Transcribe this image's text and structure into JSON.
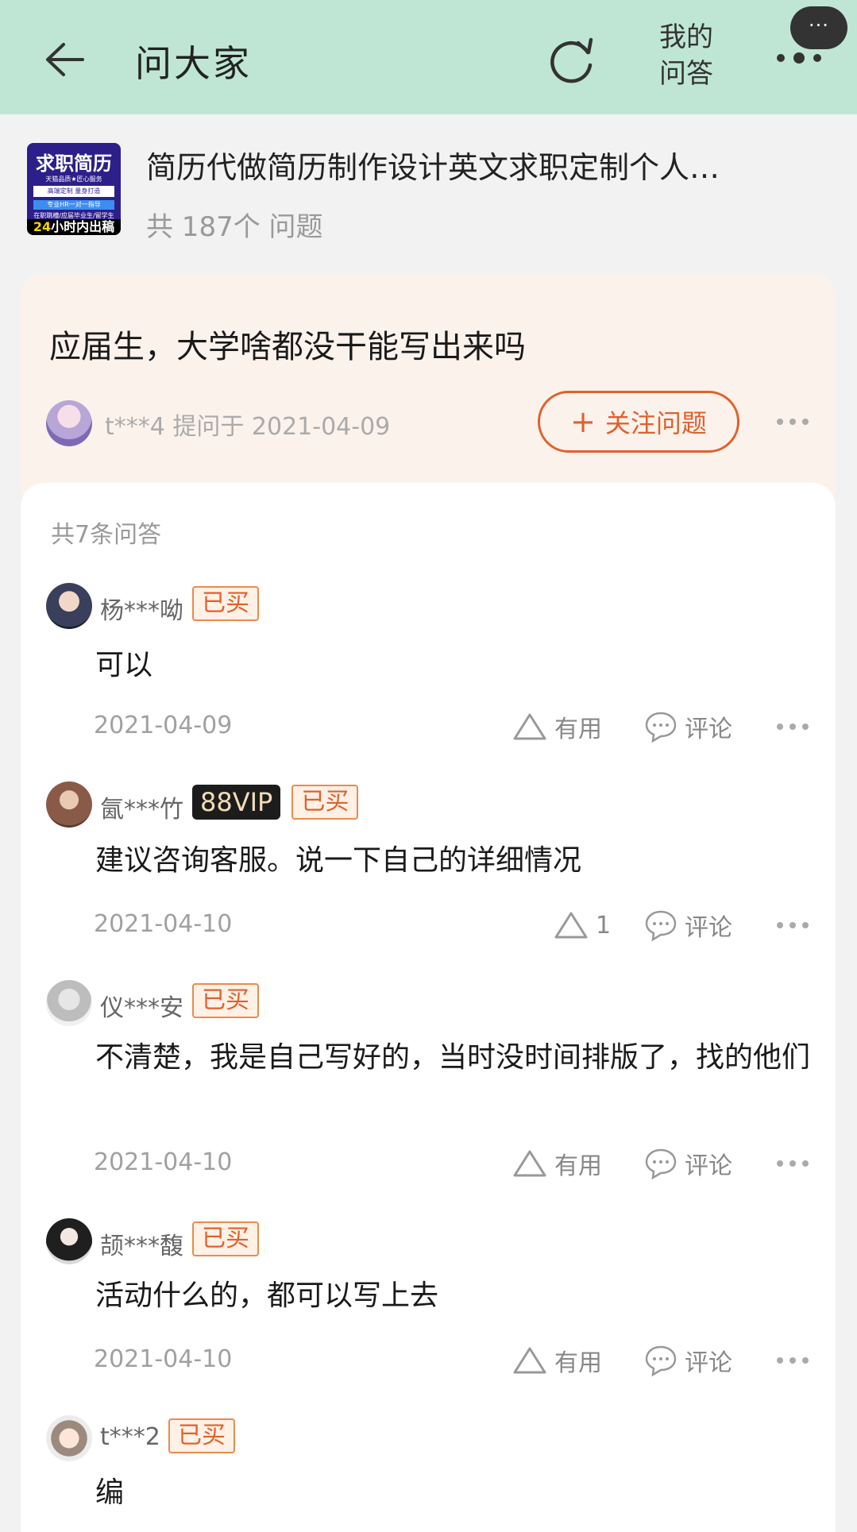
{
  "header": {
    "title": "问大家",
    "my_qa_line1": "我的",
    "my_qa_line2": "问答",
    "more_bubble": "···"
  },
  "product": {
    "thumb_title": "求职简历",
    "thumb_line1": "天猫品质★匠心服务",
    "thumb_chip1": "高端定制  量身打造",
    "thumb_chip2": "专业HR一对一指导",
    "thumb_line2": "在职跳槽/应届毕业生/留学生",
    "thumb_hours": "24",
    "thumb_hours_suffix": "小时内出稿",
    "title": "简历代做简历制作设计英文求职定制个人…",
    "question_count": "共 187个 问题"
  },
  "question": {
    "text": "应届生，大学啥都没干能写出来吗",
    "meta": "t***4 提问于 2021-04-09",
    "follow_label": "关注问题"
  },
  "answers_count": "共7条问答",
  "answers": [
    {
      "name": "杨***呦",
      "tag": "已买",
      "text": "可以",
      "date": "2021-04-09",
      "useful": "有用",
      "comment": "评论"
    },
    {
      "name": "氤***竹",
      "vip": "88VIP",
      "tag": "已买",
      "text": "建议咨询客服。说一下自己的详细情况",
      "date": "2021-04-10",
      "useful": "1",
      "comment": "评论"
    },
    {
      "name": "仪***安",
      "tag": "已买",
      "text": "不清楚，我是自己写好的，当时没时间排版了，找的他们",
      "date": "2021-04-10",
      "useful": "有用",
      "comment": "评论"
    },
    {
      "name": "颉***馥",
      "tag": "已买",
      "text": "活动什么的，都可以写上去",
      "date": "2021-04-10",
      "useful": "有用",
      "comment": "评论"
    },
    {
      "name": "t***2",
      "tag": "已买",
      "text": "编"
    }
  ],
  "colors": {
    "header_bg": "#bfe6d5",
    "accent": "#e0612c",
    "question_card_bg": "#fcf2ec",
    "vip_bg": "#1c1c1c"
  }
}
